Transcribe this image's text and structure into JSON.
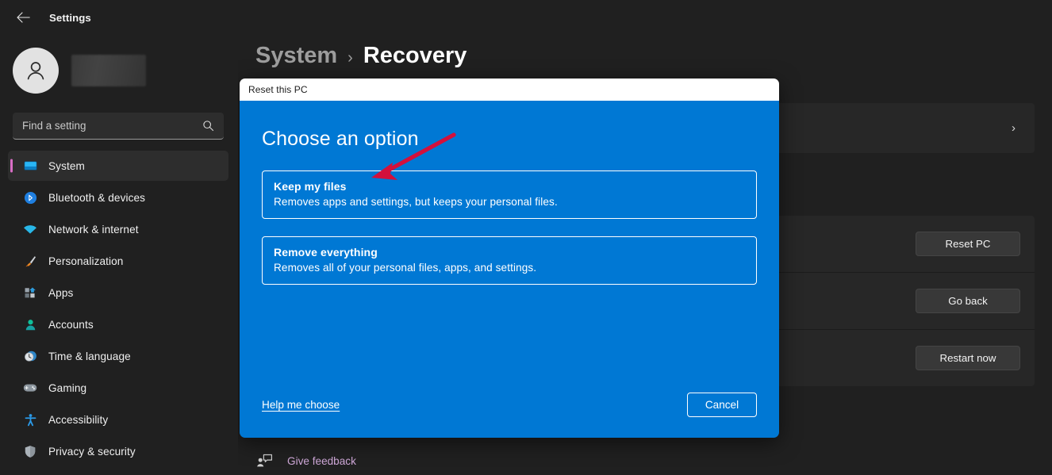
{
  "window": {
    "back_icon": "back-arrow-icon",
    "title": "Settings"
  },
  "sidebar": {
    "account": {
      "avatar_icon": "person-avatar-icon",
      "name_redacted": ""
    },
    "search": {
      "placeholder": "Find a setting",
      "value": "",
      "icon": "search-icon"
    },
    "items": [
      {
        "label": "System",
        "icon": "monitor-icon",
        "active": true
      },
      {
        "label": "Bluetooth & devices",
        "icon": "bluetooth-icon",
        "active": false
      },
      {
        "label": "Network & internet",
        "icon": "wifi-icon",
        "active": false
      },
      {
        "label": "Personalization",
        "icon": "paintbrush-icon",
        "active": false
      },
      {
        "label": "Apps",
        "icon": "apps-icon",
        "active": false
      },
      {
        "label": "Accounts",
        "icon": "account-person-icon",
        "active": false
      },
      {
        "label": "Time & language",
        "icon": "clock-icon",
        "active": false
      },
      {
        "label": "Gaming",
        "icon": "gamepad-icon",
        "active": false
      },
      {
        "label": "Accessibility",
        "icon": "accessibility-person-icon",
        "active": false
      },
      {
        "label": "Privacy & security",
        "icon": "shield-icon",
        "active": false
      }
    ]
  },
  "main": {
    "breadcrumb": {
      "parent": "System",
      "separator": "›",
      "current": "Recovery"
    },
    "rows": [
      {
        "button": "",
        "chevron": "›"
      },
      {
        "button": "",
        "chevron": ""
      },
      {
        "button": "Reset PC",
        "chevron": ""
      },
      {
        "button": "Go back",
        "chevron": ""
      },
      {
        "button": "Restart now",
        "chevron": ""
      }
    ],
    "feedback": {
      "label": "Give feedback",
      "icon": "feedback-person-icon"
    }
  },
  "modal": {
    "title": "Reset this PC",
    "heading": "Choose an option",
    "options": [
      {
        "title": "Keep my files",
        "description": "Removes apps and settings, but keeps your personal files."
      },
      {
        "title": "Remove everything",
        "description": "Removes all of your personal files, apps, and settings."
      }
    ],
    "help_link": "Help me choose",
    "cancel_label": "Cancel"
  },
  "annotation": {
    "arrow_icon": "red-pointer-arrow",
    "color": "#d3103c"
  },
  "colors": {
    "accent_blue": "#0078d4",
    "window_bg": "#202020",
    "card_bg": "#272727",
    "nav_active_bar": "#d86ec5",
    "feedback_link": "#cfa8d8"
  }
}
